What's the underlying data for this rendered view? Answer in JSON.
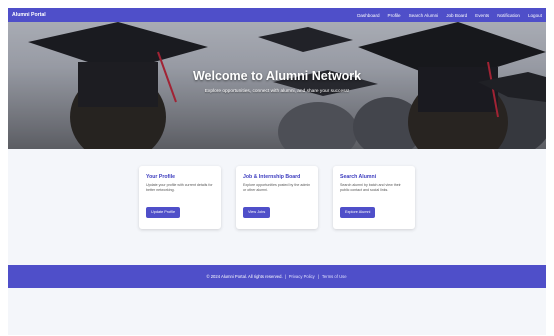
{
  "navbar": {
    "brand": "Alumni Portal",
    "links": [
      "Dashboard",
      "Profile",
      "Search Alumni",
      "Job Board",
      "Events",
      "Notification",
      "Logout"
    ]
  },
  "hero": {
    "title": "Welcome to Alumni Network",
    "subtitle": "Explore opportunities, connect with alumni, and share your success!"
  },
  "cards": [
    {
      "title": "Your Profile",
      "description": "Update your profile with current details for better networking.",
      "button": "Update Profile"
    },
    {
      "title": "Job & Internship Board",
      "description": "Explore opportunities posted by the admin or other alumni.",
      "button": "View Jobs"
    },
    {
      "title": "Search Alumni",
      "description": "Search alumni by batch and view their public contact and social links.",
      "button": "Explore Alumni"
    }
  ],
  "footer": {
    "copyright": "© 2024 Alumni Portal. All rights reserved.",
    "separator": "|",
    "privacy": "Privacy Policy",
    "terms": "Terms of Use"
  },
  "colors": {
    "primary": "#4f4fc9",
    "card_title": "#3d3dbf",
    "page_bg": "#f4f6fa"
  }
}
